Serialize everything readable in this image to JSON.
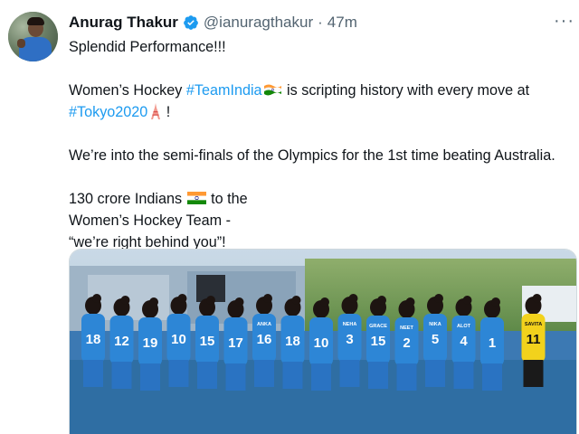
{
  "tweet": {
    "author_name": "Anurag Thakur",
    "handle": "@ianuragthakur",
    "separator": "·",
    "time": "47m",
    "menu_dots": "···",
    "line1": "Splendid Performance!!!",
    "line2_prefix": "Women’s Hockey ",
    "hashtag1": "#TeamIndia",
    "line2_suffix": " is scripting history with every move at",
    "hashtag2": "#Tokyo2020",
    "line3_suffix": " !",
    "line4": "We’re into the semi-finals of the Olympics for the 1st time beating Australia.",
    "line5_prefix": "130 crore Indians ",
    "line5_suffix": " to the",
    "line6": "Women’s Hockey Team -",
    "line7": "“we’re right behind you”!"
  },
  "photo": {
    "jerseys": [
      {
        "text": "18",
        "color": "#2d86d6"
      },
      {
        "text": "12",
        "color": "#2d86d6"
      },
      {
        "text": "19",
        "color": "#2d86d6"
      },
      {
        "text": "10",
        "color": "#2d86d6"
      },
      {
        "text": "15",
        "color": "#2d86d6"
      },
      {
        "text": "17",
        "color": "#2d86d6"
      },
      {
        "text": "16",
        "color": "#2d86d6"
      },
      {
        "text": "18",
        "color": "#2d86d6"
      },
      {
        "text": "10",
        "color": "#2d86d6"
      },
      {
        "text": "3",
        "color": "#2d86d6"
      },
      {
        "text": "15",
        "color": "#2d86d6"
      },
      {
        "text": "2",
        "color": "#2d86d6"
      },
      {
        "text": "5",
        "color": "#2d86d6"
      },
      {
        "text": "4",
        "color": "#2d86d6"
      },
      {
        "text": "1",
        "color": "#2d86d6"
      },
      {
        "text": "11",
        "color": "#f2d21c"
      }
    ],
    "back_names": [
      "ANKA",
      "NEHA",
      "GRACE",
      "NEET",
      "NIKA",
      "ALOT",
      "SAVITA"
    ]
  },
  "colors": {
    "link": "#1d9bf0",
    "verified": "#1d9bf0",
    "text": "#0f1419",
    "muted": "#536471"
  },
  "icons": {
    "verified": "verified-badge-icon",
    "flag": "india-flag-icon",
    "tower": "tokyo-tower-icon",
    "menu": "more-options-icon"
  }
}
